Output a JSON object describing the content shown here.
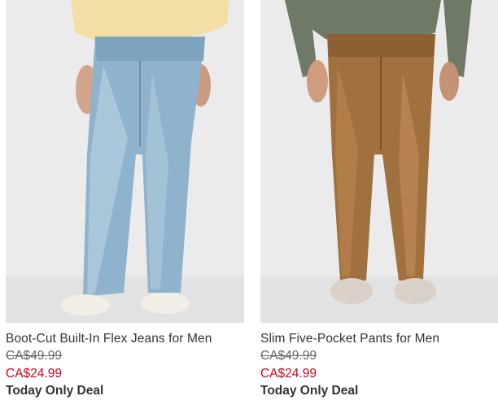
{
  "products": [
    {
      "name": "Boot-Cut Built-In Flex Jeans for Men",
      "original_price": "CA$49.99",
      "sale_price": "CA$24.99",
      "promo": "Today Only Deal",
      "image_alt": "Boot-Cut Built-In Flex Jeans for Men"
    },
    {
      "name": "Slim Five-Pocket Pants for Men",
      "original_price": "CA$49.99",
      "sale_price": "CA$24.99",
      "promo": "Today Only Deal",
      "image_alt": "Slim Five-Pocket Pants for Men"
    }
  ],
  "colors": {
    "sale_price": "#d0021b",
    "text": "#333333",
    "strike_price": "#666666"
  }
}
